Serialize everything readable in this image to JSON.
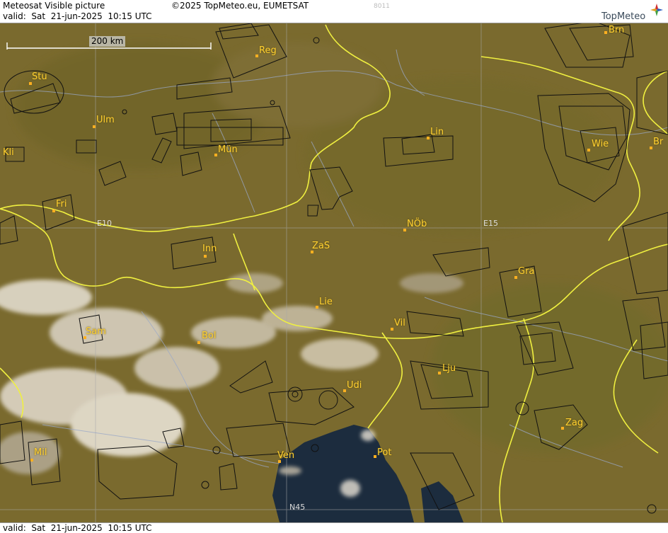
{
  "header": {
    "title": "Meteosat Visible picture",
    "valid": "valid:  Sat  21-jun-2025  10:15 UTC",
    "copyright": "©2025 TopMeteo.eu, EUMETSAT",
    "code": "8011",
    "logo": "TopMeteo"
  },
  "footer": {
    "valid": "valid:  Sat  21-jun-2025  10:15 UTC"
  },
  "scale": {
    "label": "200 km"
  },
  "grid_labels": {
    "e10": "E10",
    "e15": "E15",
    "n45": "N45"
  },
  "cities": {
    "reg": "Reg",
    "brn": "Brn",
    "stu": "Stu",
    "ulm": "Ulm",
    "mun": "Mün",
    "lin": "Lin",
    "wie": "Wie",
    "br": "Br",
    "kli": "Kli",
    "fri": "Fri",
    "inn": "Inn",
    "zas": "ZaS",
    "nob": "NÖb",
    "gra": "Gra",
    "lie": "Lie",
    "vil": "Vil",
    "sam": "Sam",
    "bol": "Bol",
    "lju": "Lju",
    "udi": "Udi",
    "zag": "Zag",
    "mil": "Mil",
    "ven": "Ven",
    "pot": "Pot"
  },
  "colors": {
    "terrain": "#7a6a2e",
    "border": "#f0f040",
    "cloud": "#e8e2d6",
    "sea": "#1c2c3e",
    "city_label": "#ffd030"
  }
}
